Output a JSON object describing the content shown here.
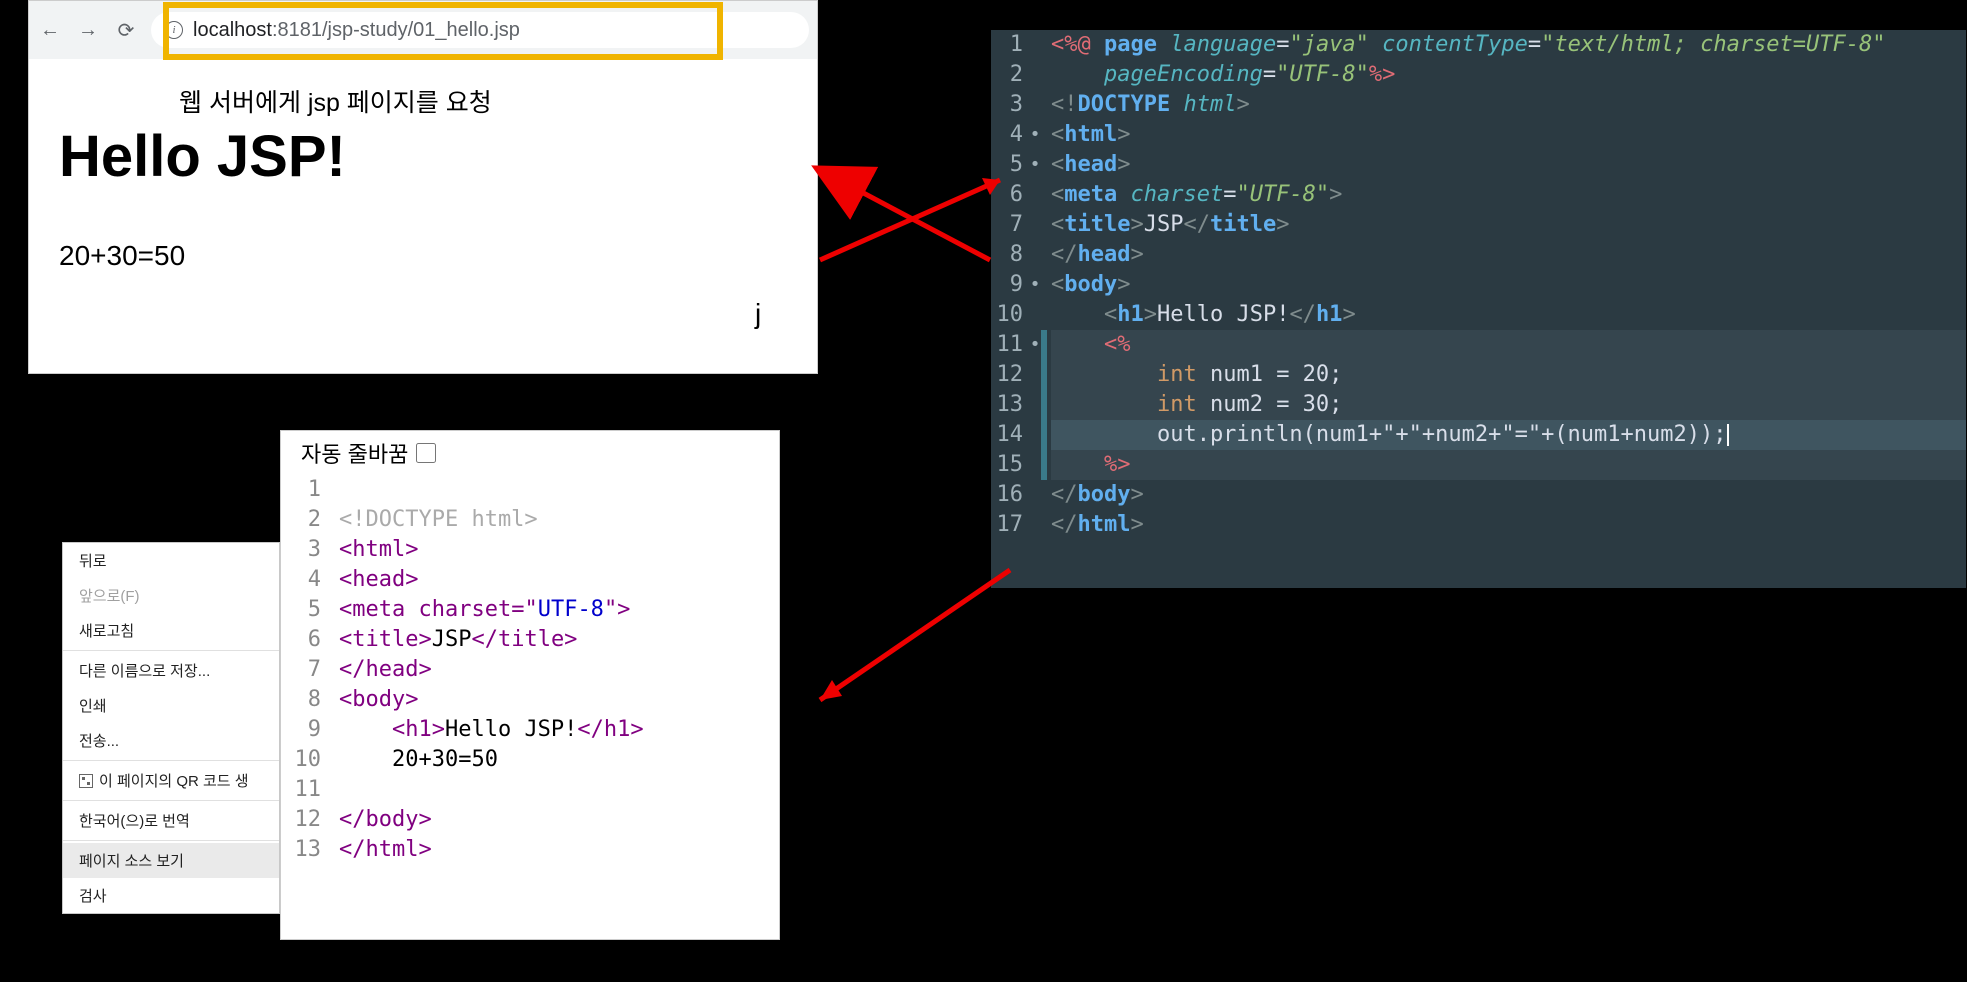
{
  "browser": {
    "url_host": "localhost",
    "url_port": ":8181",
    "url_path": "/jsp-study/01_hello.jsp",
    "annotation": "웹 서버에게 jsp 페이지를 요청",
    "h1": "Hello JSP!",
    "calc": "20+30=50"
  },
  "ctxmenu": {
    "items": [
      {
        "label": "뒤로",
        "disabled": false
      },
      {
        "label": "앞으로(F)",
        "disabled": true
      },
      {
        "label": "새로고침",
        "disabled": false
      },
      {
        "label": "다른 이름으로 저장...",
        "disabled": false
      },
      {
        "label": "인쇄",
        "disabled": false
      },
      {
        "label": "전송...",
        "disabled": false
      },
      {
        "label": "이 페이지의 QR 코드 생",
        "disabled": false
      },
      {
        "label": "한국어(으)로 번역",
        "disabled": false
      },
      {
        "label": "페이지 소스 보기",
        "disabled": false
      },
      {
        "label": "검사",
        "disabled": false
      }
    ]
  },
  "src": {
    "toolbar": "자동 줄바꿈",
    "lines": [
      {
        "n": 1,
        "html": ""
      },
      {
        "n": 2,
        "html": "<!DOCTYPE html>",
        "gray": true
      },
      {
        "n": 3,
        "html": "<html>"
      },
      {
        "n": 4,
        "html": "<head>"
      },
      {
        "n": 5,
        "html": "<meta charset=\"UTF-8\">"
      },
      {
        "n": 6,
        "html": "<title>JSP</title>"
      },
      {
        "n": 7,
        "html": "</head>"
      },
      {
        "n": 8,
        "html": "<body>"
      },
      {
        "n": 9,
        "html": "    <h1>Hello JSP!</h1>"
      },
      {
        "n": 10,
        "html": "    20+30=50",
        "plain": true
      },
      {
        "n": 11,
        "html": ""
      },
      {
        "n": 12,
        "html": "</body>"
      },
      {
        "n": 13,
        "html": "</html>"
      }
    ]
  },
  "editor": {
    "lines": [
      {
        "n": 1
      },
      {
        "n": 2
      },
      {
        "n": 3
      },
      {
        "n": 4,
        "m": "•"
      },
      {
        "n": 5,
        "m": "•"
      },
      {
        "n": 6
      },
      {
        "n": 7
      },
      {
        "n": 8
      },
      {
        "n": 9,
        "m": "•"
      },
      {
        "n": 10
      },
      {
        "n": 11,
        "m": "•",
        "c": true
      },
      {
        "n": 12,
        "c": true
      },
      {
        "n": 13,
        "c": true
      },
      {
        "n": 14,
        "c": true
      },
      {
        "n": 15,
        "c": true
      },
      {
        "n": 16
      },
      {
        "n": 17
      }
    ],
    "code": {
      "l1_a": "<%@",
      "l1_b": " page ",
      "l1_c": "language",
      "l1_d": "=",
      "l1_e": "\"java\"",
      "l1_f": " contentType",
      "l1_g": "=",
      "l1_h": "\"text/html; charset=UTF-8\"",
      "l2_a": "    pageEncoding",
      "l2_b": "=",
      "l2_c": "\"UTF-8\"",
      "l2_d": "%>",
      "l3_a": "<!",
      "l3_b": "DOCTYPE ",
      "l3_c": "html",
      "l3_d": ">",
      "l4": "<",
      "l4_b": "html",
      "l4_c": ">",
      "l5": "<",
      "l5_b": "head",
      "l5_c": ">",
      "l6_a": "<",
      "l6_b": "meta ",
      "l6_c": "charset",
      "l6_d": "=",
      "l6_e": "\"UTF-8\"",
      "l6_f": ">",
      "l7_a": "<",
      "l7_b": "title",
      "l7_c": ">",
      "l7_d": "JSP",
      "l7_e": "</",
      "l7_f": "title",
      "l7_g": ">",
      "l8_a": "</",
      "l8_b": "head",
      "l8_c": ">",
      "l9_a": "<",
      "l9_b": "body",
      "l9_c": ">",
      "l10_a": "    <",
      "l10_b": "h1",
      "l10_c": ">",
      "l10_d": "Hello JSP!",
      "l10_e": "</",
      "l10_f": "h1",
      "l10_g": ">",
      "l11": "    <%",
      "l12_a": "        ",
      "l12_b": "int",
      "l12_c": " num1 = 20;",
      "l13_a": "        ",
      "l13_b": "int",
      "l13_c": " num2 = 30;",
      "l14": "        out.println(num1+\"+\"+num2+\"=\"+(num1+num2));",
      "l15": "    %>",
      "l16_a": "</",
      "l16_b": "body",
      "l16_c": ">",
      "l17_a": "</",
      "l17_b": "html",
      "l17_c": ">"
    }
  }
}
